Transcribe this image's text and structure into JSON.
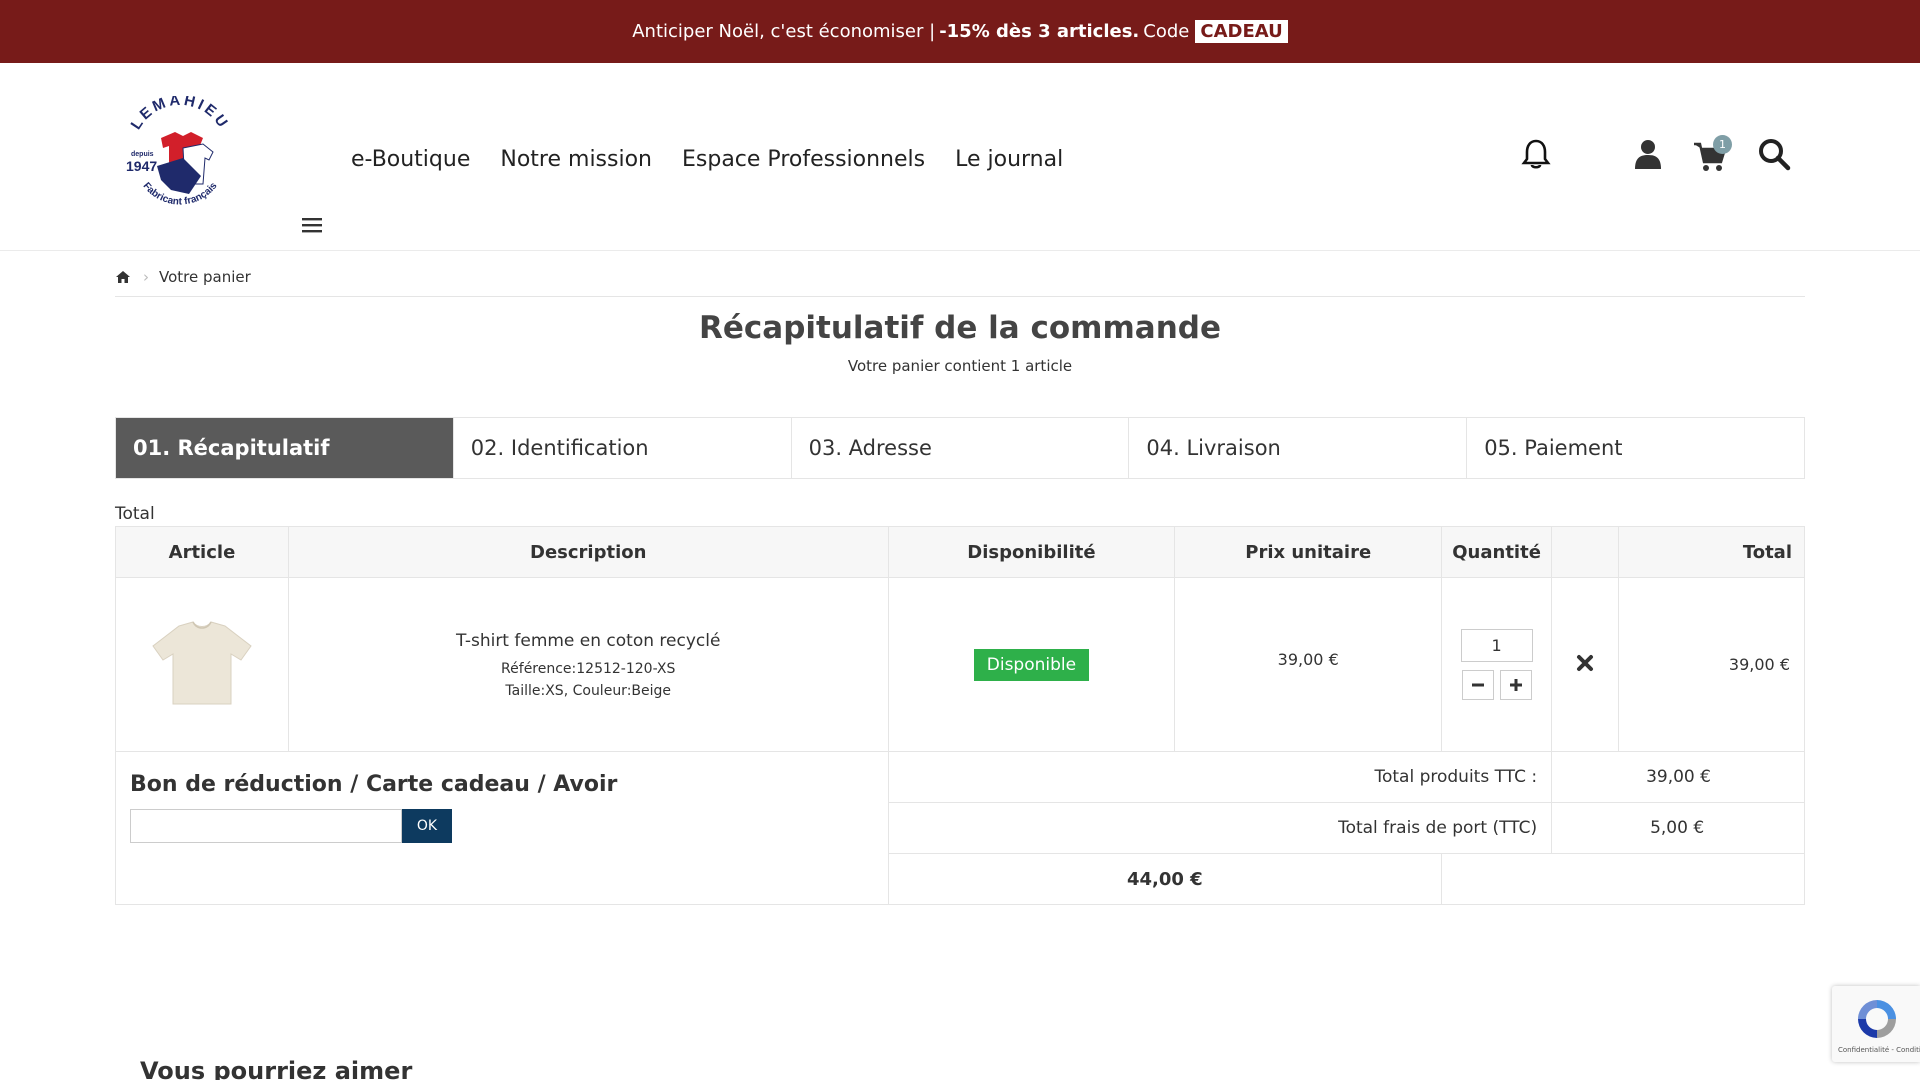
{
  "promo": {
    "text": "Anticiper Noël, c'est économiser | ",
    "highlight": "-15% dès 3 articles.",
    "code_prefix": "Code",
    "code": "CADEAU"
  },
  "logo": {
    "brand": "LEMAHIEU",
    "since_label": "depuis",
    "year": "1947",
    "tagline": "Fabricant français"
  },
  "nav": {
    "items": [
      "e-Boutique",
      "Notre mission",
      "Espace Professionnels",
      "Le journal"
    ]
  },
  "header": {
    "cart_count": "1"
  },
  "breadcrumb": {
    "current": "Votre panier"
  },
  "page": {
    "title": "Récapitulatif de la commande",
    "subtitle": "Votre panier contient 1 article"
  },
  "steps": [
    "01. Récapitulatif",
    "02. Identification",
    "03. Adresse",
    "04. Livraison",
    "05. Paiement"
  ],
  "cart": {
    "total_label": "Total",
    "columns": [
      "Article",
      "Description",
      "Disponibilité",
      "Prix unitaire",
      "Quantité",
      "",
      "Total"
    ],
    "items": [
      {
        "name": "T-shirt femme en coton recyclé",
        "reference": "Référence:12512-120-XS",
        "attributes": "Taille:XS, Couleur:Beige",
        "availability": "Disponible",
        "unit_price": "39,00 €",
        "quantity": "1",
        "total": "39,00 €"
      }
    ],
    "voucher": {
      "title": "Bon de réduction / Carte cadeau / Avoir",
      "input_value": "",
      "ok_label": "OK"
    },
    "summary": {
      "products_label": "Total produits TTC :",
      "products_value": "39,00 €",
      "shipping_label": "Total frais de port (TTC)",
      "shipping_value": "5,00 €",
      "grand_total": "44,00 €"
    }
  },
  "recommendations": {
    "title": "Vous pourriez aimer"
  },
  "recaptcha": {
    "text": "Confidentialité - Conditions"
  },
  "colors": {
    "promo_bg": "#771b19",
    "active_step": "#5a5a5a",
    "available": "#2eb04a",
    "ok_button": "#0d3a5f"
  }
}
